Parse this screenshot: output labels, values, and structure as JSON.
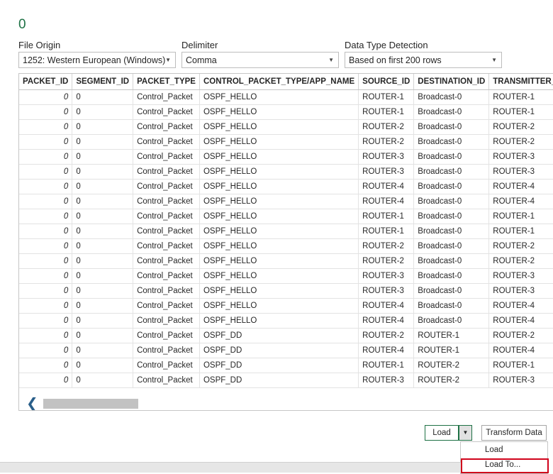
{
  "header": {
    "title": "0"
  },
  "options": {
    "file_origin": {
      "label": "File Origin",
      "value": "1252: Western European (Windows)"
    },
    "delimiter": {
      "label": "Delimiter",
      "value": "Comma"
    },
    "detection": {
      "label": "Data Type Detection",
      "value": "Based on first 200 rows"
    }
  },
  "grid": {
    "columns": [
      "PACKET_ID",
      "SEGMENT_ID",
      "PACKET_TYPE",
      "CONTROL_PACKET_TYPE/APP_NAME",
      "SOURCE_ID",
      "DESTINATION_ID",
      "TRANSMITTER_ID"
    ],
    "rows": [
      [
        "0",
        "0",
        "Control_Packet",
        "OSPF_HELLO",
        "ROUTER-1",
        "Broadcast-0",
        "ROUTER-1"
      ],
      [
        "0",
        "0",
        "Control_Packet",
        "OSPF_HELLO",
        "ROUTER-1",
        "Broadcast-0",
        "ROUTER-1"
      ],
      [
        "0",
        "0",
        "Control_Packet",
        "OSPF_HELLO",
        "ROUTER-2",
        "Broadcast-0",
        "ROUTER-2"
      ],
      [
        "0",
        "0",
        "Control_Packet",
        "OSPF_HELLO",
        "ROUTER-2",
        "Broadcast-0",
        "ROUTER-2"
      ],
      [
        "0",
        "0",
        "Control_Packet",
        "OSPF_HELLO",
        "ROUTER-3",
        "Broadcast-0",
        "ROUTER-3"
      ],
      [
        "0",
        "0",
        "Control_Packet",
        "OSPF_HELLO",
        "ROUTER-3",
        "Broadcast-0",
        "ROUTER-3"
      ],
      [
        "0",
        "0",
        "Control_Packet",
        "OSPF_HELLO",
        "ROUTER-4",
        "Broadcast-0",
        "ROUTER-4"
      ],
      [
        "0",
        "0",
        "Control_Packet",
        "OSPF_HELLO",
        "ROUTER-4",
        "Broadcast-0",
        "ROUTER-4"
      ],
      [
        "0",
        "0",
        "Control_Packet",
        "OSPF_HELLO",
        "ROUTER-1",
        "Broadcast-0",
        "ROUTER-1"
      ],
      [
        "0",
        "0",
        "Control_Packet",
        "OSPF_HELLO",
        "ROUTER-1",
        "Broadcast-0",
        "ROUTER-1"
      ],
      [
        "0",
        "0",
        "Control_Packet",
        "OSPF_HELLO",
        "ROUTER-2",
        "Broadcast-0",
        "ROUTER-2"
      ],
      [
        "0",
        "0",
        "Control_Packet",
        "OSPF_HELLO",
        "ROUTER-2",
        "Broadcast-0",
        "ROUTER-2"
      ],
      [
        "0",
        "0",
        "Control_Packet",
        "OSPF_HELLO",
        "ROUTER-3",
        "Broadcast-0",
        "ROUTER-3"
      ],
      [
        "0",
        "0",
        "Control_Packet",
        "OSPF_HELLO",
        "ROUTER-3",
        "Broadcast-0",
        "ROUTER-3"
      ],
      [
        "0",
        "0",
        "Control_Packet",
        "OSPF_HELLO",
        "ROUTER-4",
        "Broadcast-0",
        "ROUTER-4"
      ],
      [
        "0",
        "0",
        "Control_Packet",
        "OSPF_HELLO",
        "ROUTER-4",
        "Broadcast-0",
        "ROUTER-4"
      ],
      [
        "0",
        "0",
        "Control_Packet",
        "OSPF_DD",
        "ROUTER-2",
        "ROUTER-1",
        "ROUTER-2"
      ],
      [
        "0",
        "0",
        "Control_Packet",
        "OSPF_DD",
        "ROUTER-4",
        "ROUTER-1",
        "ROUTER-4"
      ],
      [
        "0",
        "0",
        "Control_Packet",
        "OSPF_DD",
        "ROUTER-1",
        "ROUTER-2",
        "ROUTER-1"
      ],
      [
        "0",
        "0",
        "Control_Packet",
        "OSPF_DD",
        "ROUTER-3",
        "ROUTER-2",
        "ROUTER-3"
      ]
    ]
  },
  "footer": {
    "load_label": "Load",
    "dropdown_icon": "chevron-down-icon",
    "transform_label": "Transform Data",
    "menu": [
      "Load",
      "Load To..."
    ]
  },
  "colors": {
    "accent": "#1e7145",
    "highlight": "#d0021b"
  }
}
